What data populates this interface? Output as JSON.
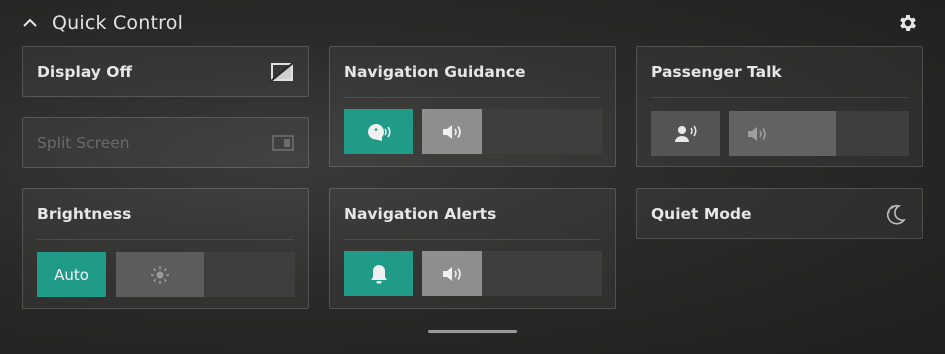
{
  "header": {
    "title": "Quick Control",
    "collapse_icon": "chevron-up-icon",
    "settings_icon": "gear-icon"
  },
  "display_off": {
    "label": "Display Off",
    "icon": "display-off-icon"
  },
  "split_screen": {
    "label": "Split Screen",
    "icon": "split-screen-icon",
    "enabled": false
  },
  "brightness": {
    "label": "Brightness",
    "auto_label": "Auto",
    "icon": "sun-icon",
    "level": 0.49
  },
  "navigation_guidance": {
    "label": "Navigation Guidance",
    "voice_icon": "voice-guidance-icon",
    "volume_icon": "speaker-icon",
    "volume": 0.33
  },
  "navigation_alerts": {
    "label": "Navigation Alerts",
    "alert_icon": "bell-icon",
    "volume_icon": "speaker-icon",
    "volume": 0.33
  },
  "passenger_talk": {
    "label": "Passenger Talk",
    "talk_icon": "passenger-talk-icon",
    "volume_icon": "speaker-icon",
    "volume": 0.6
  },
  "quiet_mode": {
    "label": "Quiet Mode",
    "icon": "moon-stars-icon"
  },
  "colors": {
    "accent": "#1f9b87",
    "card_border": "#3f3f3f",
    "background": "#262626"
  }
}
